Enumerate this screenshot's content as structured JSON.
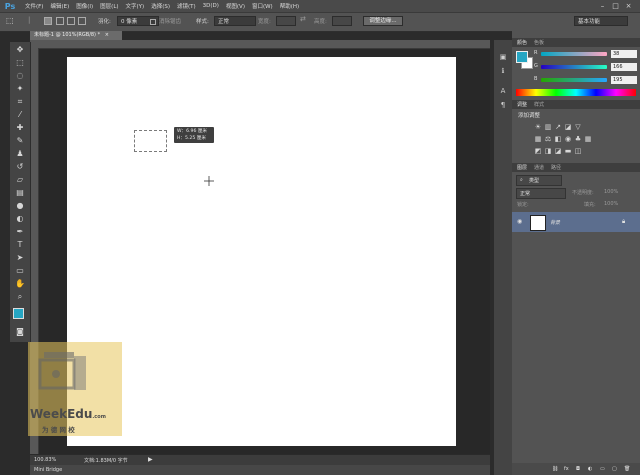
{
  "app": {
    "logo": "Ps"
  },
  "menu": [
    "文件(F)",
    "编辑(E)",
    "图像(I)",
    "图层(L)",
    "文字(Y)",
    "选择(S)",
    "滤镜(T)",
    "3D(D)",
    "视图(V)",
    "窗口(W)",
    "帮助(H)"
  ],
  "window_controls": [
    "–",
    "□",
    "×"
  ],
  "options": {
    "feather_label": "羽化:",
    "feather_value": "0 像素",
    "antialias_label": "消除锯齿",
    "style_label": "样式:",
    "style_value": "正常",
    "width_label": "宽度:",
    "height_label": "高度:",
    "refine_edge": "调整边缘...",
    "workspace": "基本功能"
  },
  "document": {
    "tab_title": "未标题-1 @ 101%(RGB/8) *",
    "tab_close": "×"
  },
  "tooltip": {
    "w": "W：6.96 厘米",
    "h": "H：5.25 厘米"
  },
  "status": {
    "zoom": "100.83%",
    "doc_info": "文档:1.83M/0 字节",
    "bottom_tab": "Mini Bridge"
  },
  "watermark": {
    "brand": "WeekEdu",
    "domain": ".com",
    "sub": "为 德 网 校"
  },
  "color_panel": {
    "tabs": [
      "颜色",
      "色板"
    ],
    "r_label": "R",
    "g_label": "G",
    "b_label": "B",
    "r": "38",
    "g": "166",
    "b": "195",
    "fg_color": "#26a6c3"
  },
  "adjustments_panel": {
    "tabs": [
      "调整",
      "样式"
    ],
    "title": "添加调整"
  },
  "layers_panel": {
    "tabs": [
      "图层",
      "通道",
      "路径"
    ],
    "filter_label": "类型",
    "blend_mode": "正常",
    "opacity_label": "不透明度:",
    "opacity_value": "100%",
    "lock_label": "锁定:",
    "fill_label": "填充:",
    "fill_value": "100%",
    "layer_name": "背景"
  },
  "icons": [
    "move-icon",
    "marquee-icon",
    "lasso-icon",
    "magic-wand-icon",
    "crop-icon",
    "eyedropper-icon",
    "healing-icon",
    "brush-icon",
    "stamp-icon",
    "history-brush-icon",
    "eraser-icon",
    "gradient-icon",
    "blur-icon",
    "dodge-icon",
    "pen-icon",
    "text-icon",
    "path-select-icon",
    "shape-icon",
    "hand-icon",
    "zoom-icon"
  ]
}
